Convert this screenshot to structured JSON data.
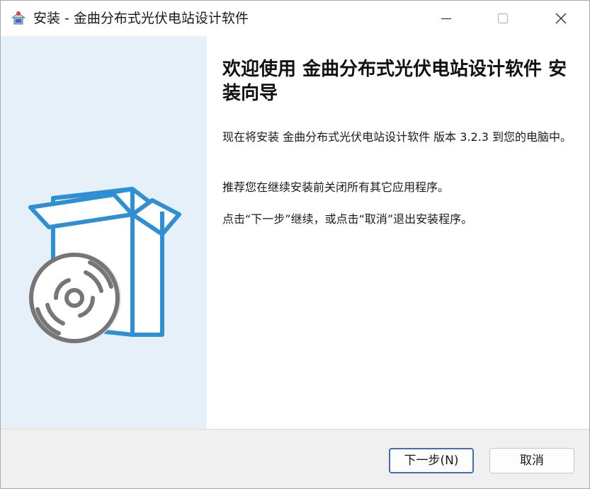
{
  "window": {
    "title": "安装 - 金曲分布式光伏电站设计软件",
    "app_icon": "installer-app-icon",
    "controls": {
      "minimize_icon": "minimize-icon",
      "maximize_icon": "maximize-icon",
      "close_icon": "close-icon"
    }
  },
  "sidebar": {
    "illustration": "box-with-disc-icon",
    "background_color": "#e6f0f8",
    "accent_color": "#2e8fd2"
  },
  "content": {
    "heading": "欢迎使用 金曲分布式光伏电站设计软件 安装向导",
    "paragraphs": [
      "现在将安装 金曲分布式光伏电站设计软件 版本 3.2.3 到您的电脑中。",
      "推荐您在继续安装前关闭所有其它应用程序。",
      "点击“下一步”继续，或点击“取消”退出安装程序。"
    ]
  },
  "buttons": {
    "next_label": "下一步(N)",
    "cancel_label": "取消"
  }
}
